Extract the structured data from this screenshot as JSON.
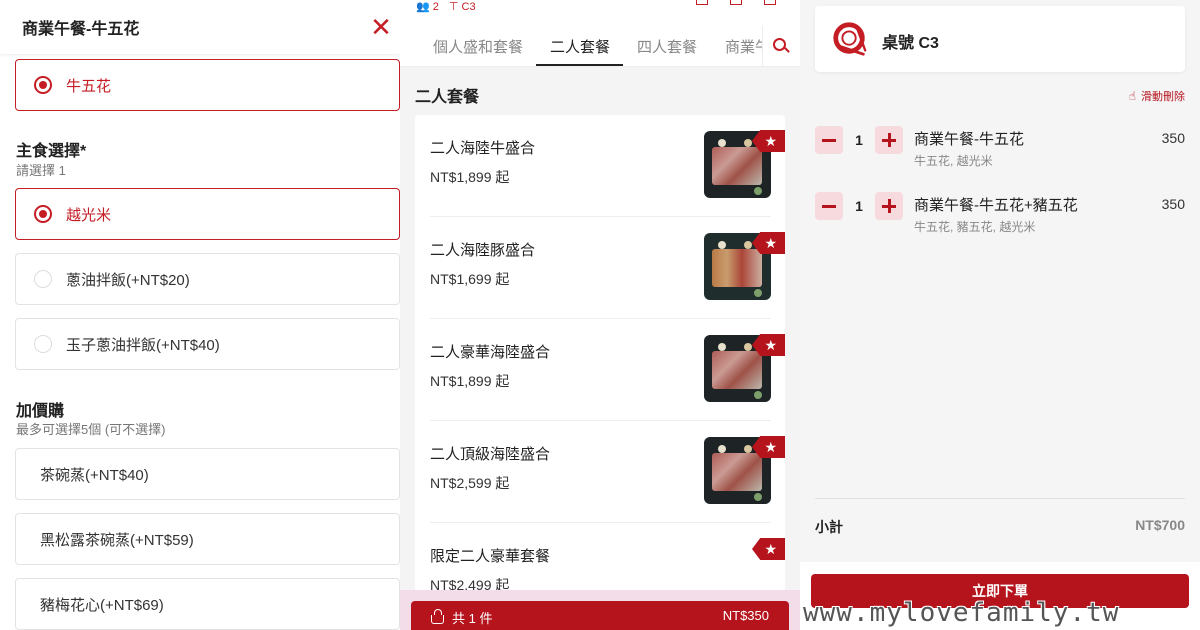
{
  "item_dialog": {
    "title": "商業午餐-牛五花",
    "selected_meat": "牛五花",
    "staple": {
      "title": "主食選擇*",
      "subtitle": "請選擇 1",
      "options": [
        "越光米",
        "蔥油拌飯(+NT$20)",
        "玉子蔥油拌飯(+NT$40)"
      ],
      "selected": "越光米"
    },
    "addons": {
      "title": "加價購",
      "subtitle": "最多可選擇5個 (可不選擇)",
      "options": [
        "茶碗蒸(+NT$40)",
        "黑松露茶碗蒸(+NT$59)",
        "豬梅花心(+NT$69)"
      ]
    }
  },
  "menu": {
    "top_bar": {
      "guests": "2",
      "table": "C3"
    },
    "tabs": [
      "個人盛和套餐",
      "二人套餐",
      "四人套餐",
      "商業午"
    ],
    "active_tab": "二人套餐",
    "category_title": "二人套餐",
    "items": [
      {
        "name": "二人海陸牛盛合",
        "price": "NT$1,899 起"
      },
      {
        "name": "二人海陸豚盛合",
        "price": "NT$1,699 起"
      },
      {
        "name": "二人豪華海陸盛合",
        "price": "NT$1,899 起"
      },
      {
        "name": "二人頂級海陸盛合",
        "price": "NT$2,599 起"
      },
      {
        "name": "限定二人豪華套餐",
        "price": "NT$2,499 起"
      }
    ],
    "cart_bar": {
      "count_label": "共 1 件",
      "total": "NT$350"
    }
  },
  "cart": {
    "table_label": "桌號 C3",
    "swipe_hint": "滑動刪除",
    "items": [
      {
        "qty": "1",
        "name": "商業午餐-牛五花",
        "options": "牛五花, 越光米",
        "price": "350"
      },
      {
        "qty": "1",
        "name": "商業午餐-牛五花+豬五花",
        "options": "牛五花, 豬五花, 越光米",
        "price": "350"
      }
    ],
    "subtotal_label": "小計",
    "subtotal_value": "NT$700",
    "order_button": "立即下單"
  },
  "watermark": "www.mylovefamily.tw",
  "colors": {
    "accent": "#c41d24",
    "accent_dark": "#b5141c",
    "qty_button_bg": "#f7dadd"
  },
  "icons": [
    "close-icon",
    "guests-icon",
    "table-icon",
    "search-icon",
    "star-icon",
    "basket-icon",
    "restaurant-logo-icon",
    "swipe-hand-icon",
    "minus-icon",
    "plus-icon"
  ]
}
